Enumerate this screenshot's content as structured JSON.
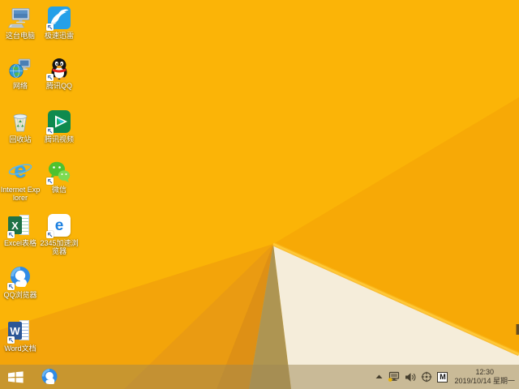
{
  "wallpaper": {
    "base": "#FBB407",
    "facet_left": "#F3A40A",
    "facet_mid": "#EA9B12",
    "facet_dark": "#DE9015",
    "wedge_tan": "#AE9552",
    "right_facet": "#F7A906",
    "cream": "#F5EDDA",
    "edge_glow": "#F9B51B",
    "edge_highlight": "#FFC837",
    "watermark_fragment_color": "#503E28"
  },
  "desktop": {
    "icons": [
      {
        "name": "this-pc",
        "label": "这台电脑",
        "shortcut": false
      },
      {
        "name": "xunlei-thunder",
        "label": "极速迅雷",
        "shortcut": true
      },
      {
        "name": "network",
        "label": "网络",
        "shortcut": false
      },
      {
        "name": "tencent-qq",
        "label": "腾讯QQ",
        "shortcut": true
      },
      {
        "name": "recycle-bin",
        "label": "回收站",
        "shortcut": false
      },
      {
        "name": "tencent-video",
        "label": "腾讯视频",
        "shortcut": true
      },
      {
        "name": "internet-explorer",
        "label": "Internet Explorer",
        "shortcut": false,
        "glyph": "e"
      },
      {
        "name": "wechat",
        "label": "微信",
        "shortcut": true
      },
      {
        "name": "excel",
        "label": "Excel表格",
        "shortcut": true,
        "glyph": "X"
      },
      {
        "name": "2345-browser",
        "label": "2345加速浏览器",
        "shortcut": true,
        "glyph": "e"
      },
      {
        "name": "qq-browser",
        "label": "QQ浏览器",
        "shortcut": true
      },
      {
        "name": "word",
        "label": "Word文档",
        "shortcut": true,
        "glyph": "W"
      }
    ]
  },
  "taskbar": {
    "tint": "rgba(158,136,84,0.5)",
    "pinned": [
      "start-button",
      "qq-browser-taskbar-button"
    ],
    "tray_icons": [
      "chevron-up-icon",
      "network-status-icon",
      "volume-icon",
      "crosshair-icon",
      "input-method-indicator"
    ],
    "input_indicator": "M",
    "clock": {
      "time": "12:30",
      "date": "2019/10/14 星期一"
    }
  }
}
